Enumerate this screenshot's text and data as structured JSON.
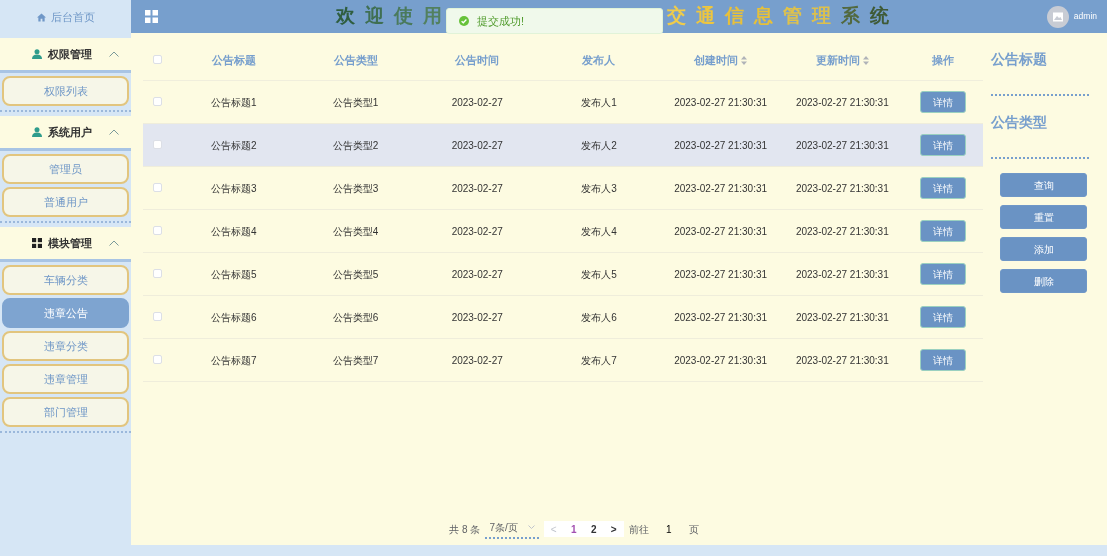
{
  "sidebar": {
    "home": {
      "label": "后台首页"
    },
    "groups": [
      {
        "label": "权限管理",
        "kind": "user",
        "expanded": true,
        "items": [
          {
            "label": "权限列表",
            "selected": false
          }
        ]
      },
      {
        "label": "系统用户",
        "kind": "user",
        "expanded": true,
        "items": [
          {
            "label": "管理员",
            "selected": false
          },
          {
            "label": "普通用户",
            "selected": false
          }
        ]
      },
      {
        "label": "模块管理",
        "kind": "grid",
        "expanded": true,
        "items": [
          {
            "label": "车辆分类",
            "selected": false
          },
          {
            "label": "违章公告",
            "selected": true
          },
          {
            "label": "违章分类",
            "selected": false
          },
          {
            "label": "违章管理",
            "selected": false
          },
          {
            "label": "部门管理",
            "selected": false
          }
        ]
      }
    ]
  },
  "header": {
    "title_start": "欢迎使用",
    "title_end": "交通信息管理系统",
    "user": "admin"
  },
  "toast": {
    "text": "提交成功!"
  },
  "table": {
    "select_all": {
      "checked": false
    },
    "columns": [
      {
        "label": "公告标题",
        "sortable": false
      },
      {
        "label": "公告类型",
        "sortable": false
      },
      {
        "label": "公告时间",
        "sortable": false
      },
      {
        "label": "发布人",
        "sortable": false
      },
      {
        "label": "创建时间",
        "sortable": true
      },
      {
        "label": "更新时间",
        "sortable": true
      },
      {
        "label": "操作",
        "sortable": false
      }
    ],
    "rows": [
      {
        "checked": false,
        "hovered": false,
        "cells": [
          "公告标题1",
          "公告类型1",
          "2023-02-27",
          "发布人1",
          "2023-02-27 21:30:31",
          "2023-02-27 21:30:31"
        ],
        "action": "详情"
      },
      {
        "checked": false,
        "hovered": true,
        "cells": [
          "公告标题2",
          "公告类型2",
          "2023-02-27",
          "发布人2",
          "2023-02-27 21:30:31",
          "2023-02-27 21:30:31"
        ],
        "action": "详情"
      },
      {
        "checked": false,
        "hovered": false,
        "cells": [
          "公告标题3",
          "公告类型3",
          "2023-02-27",
          "发布人3",
          "2023-02-27 21:30:31",
          "2023-02-27 21:30:31"
        ],
        "action": "详情"
      },
      {
        "checked": false,
        "hovered": false,
        "cells": [
          "公告标题4",
          "公告类型4",
          "2023-02-27",
          "发布人4",
          "2023-02-27 21:30:31",
          "2023-02-27 21:30:31"
        ],
        "action": "详情"
      },
      {
        "checked": false,
        "hovered": false,
        "cells": [
          "公告标题5",
          "公告类型5",
          "2023-02-27",
          "发布人5",
          "2023-02-27 21:30:31",
          "2023-02-27 21:30:31"
        ],
        "action": "详情"
      },
      {
        "checked": false,
        "hovered": false,
        "cells": [
          "公告标题6",
          "公告类型6",
          "2023-02-27",
          "发布人6",
          "2023-02-27 21:30:31",
          "2023-02-27 21:30:31"
        ],
        "action": "详情"
      },
      {
        "checked": false,
        "hovered": false,
        "cells": [
          "公告标题7",
          "公告类型7",
          "2023-02-27",
          "发布人7",
          "2023-02-27 21:30:31",
          "2023-02-27 21:30:31"
        ],
        "action": "详情"
      }
    ]
  },
  "filters": [
    {
      "label": "公告标题"
    },
    {
      "label": "公告类型"
    }
  ],
  "buttons": [
    "查询",
    "重置",
    "添加",
    "删除"
  ],
  "pagination": {
    "total": "共 8 条",
    "page_size": "7条/页",
    "pages": [
      {
        "label": "1",
        "selected": true
      },
      {
        "label": "2",
        "selected": false
      }
    ],
    "prev": "<",
    "next": ">",
    "prev_disabled": true,
    "goto": "前往",
    "goto_value": "1",
    "page_unit": "页"
  }
}
